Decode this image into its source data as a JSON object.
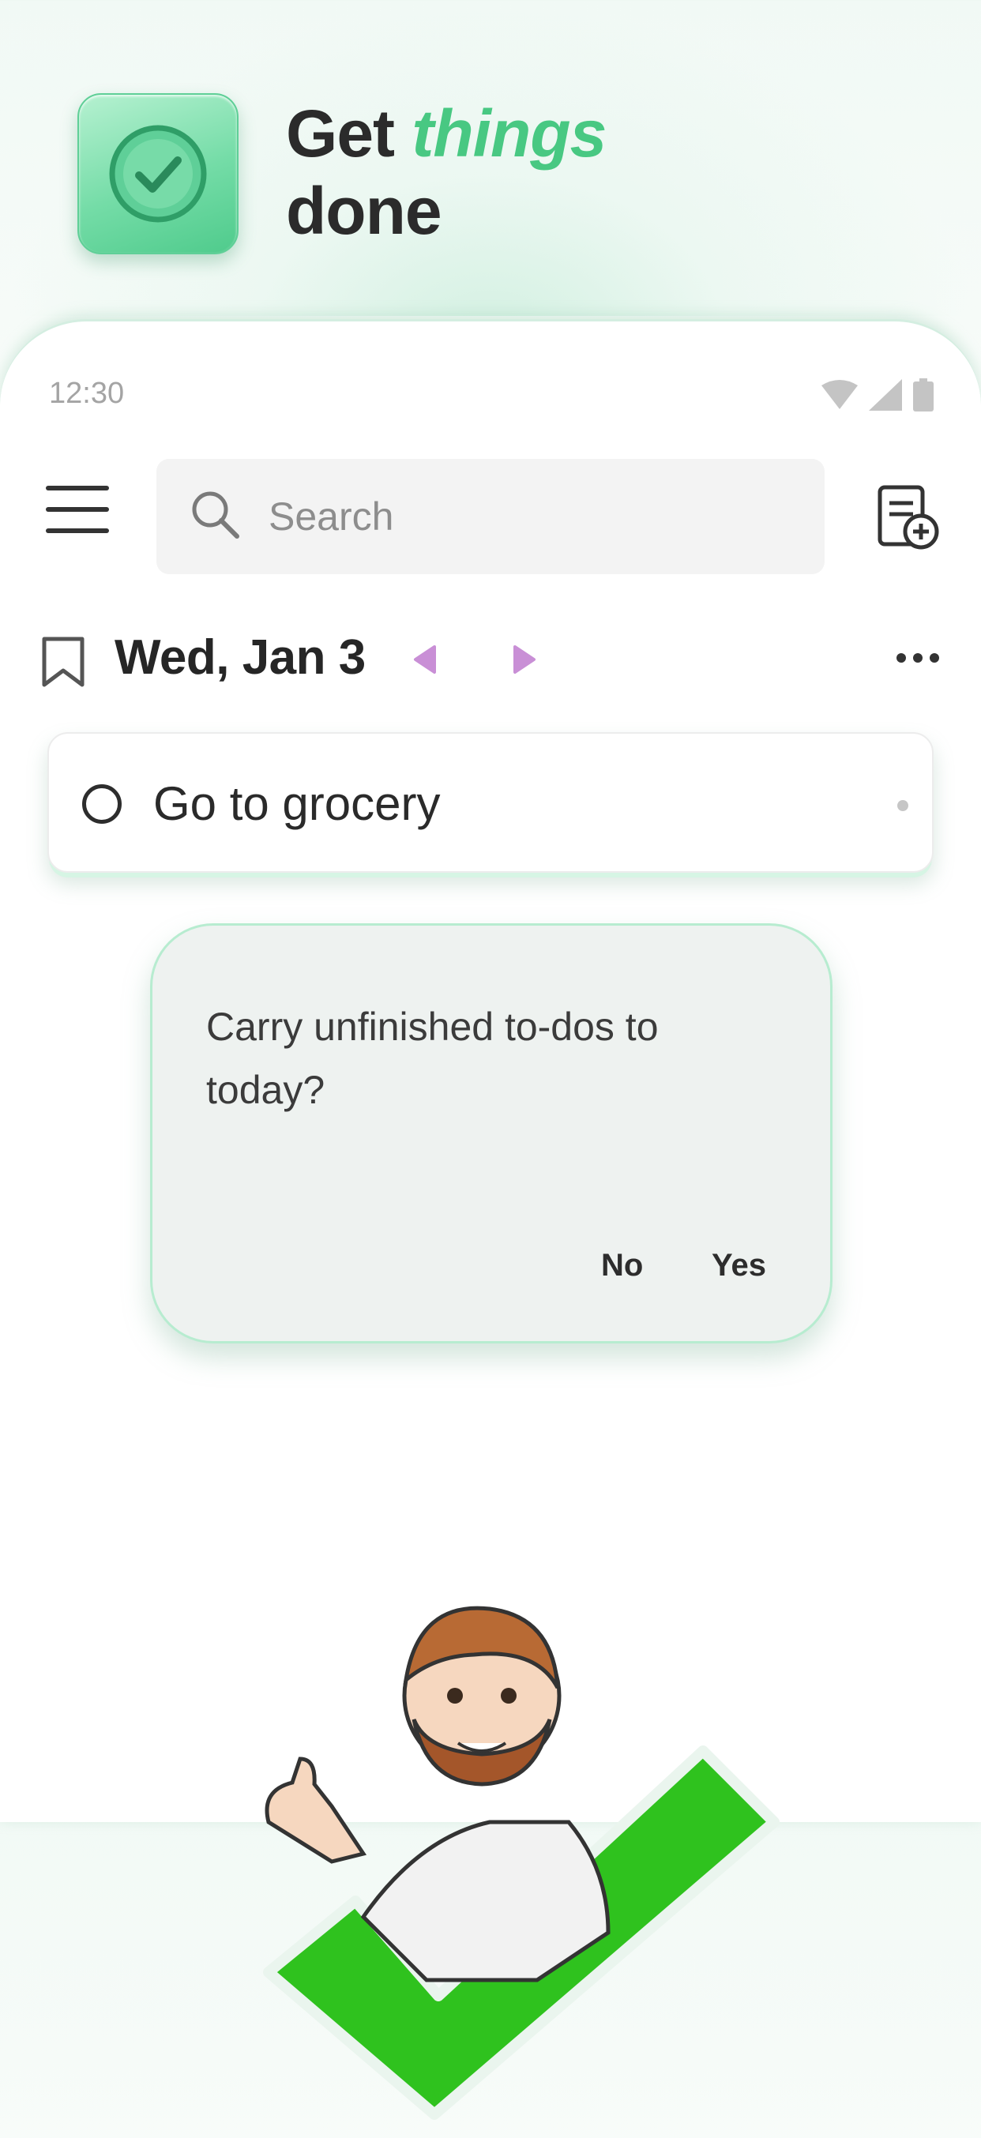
{
  "promo": {
    "headline_prefix": "Get",
    "headline_accent": "things",
    "headline_suffix": "done",
    "accent_color": "#48c882"
  },
  "status_bar": {
    "time": "12:30",
    "icons": [
      "wifi-icon",
      "signal-icon",
      "battery-icon"
    ]
  },
  "toolbar": {
    "menu_icon": "menu-icon",
    "search_placeholder": "Search",
    "search_value": "",
    "new_note_icon": "note-add-icon"
  },
  "date_header": {
    "date": "Wed, Jan 3",
    "bookmark_icon": "bookmark-icon",
    "prev_icon": "prev-day-icon",
    "next_icon": "next-day-icon",
    "more_icon": "more-icon",
    "arrow_color": "#c98fd6"
  },
  "todos": [
    {
      "text": "Go to grocery",
      "done": false
    }
  ],
  "dialog": {
    "message": "Carry unfinished to-dos to today?",
    "no_label": "No",
    "yes_label": "Yes"
  },
  "illustration": {
    "subject": "avatar-thumbs-up",
    "checkmark_color": "#2fc21e"
  }
}
